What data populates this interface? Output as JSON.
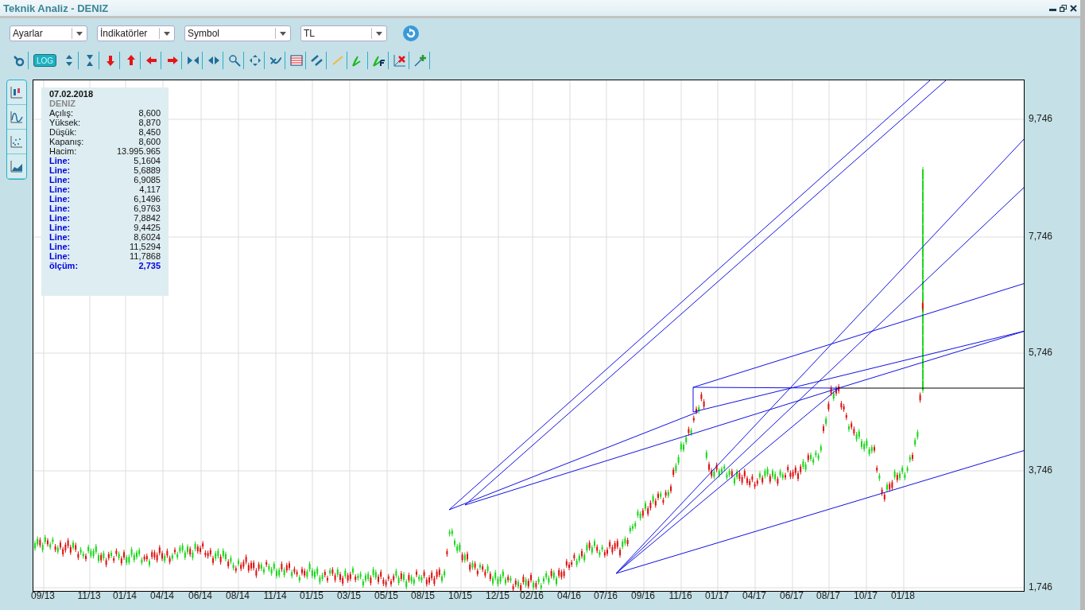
{
  "window": {
    "title": "Teknik Analiz - DENIZ"
  },
  "dropdowns": [
    {
      "value": "Ayarlar"
    },
    {
      "value": "İndikatörler"
    },
    {
      "value": "Symbol"
    },
    {
      "value": "TL"
    }
  ],
  "toolbar": {
    "log_label": "LOG",
    "log_on": true
  },
  "info": {
    "date": "07.02.2018",
    "symbol": "DENIZ",
    "rows": [
      {
        "kind": "price",
        "label": "Açılış:",
        "value": "8,600"
      },
      {
        "kind": "price",
        "label": "Yüksek:",
        "value": "8,870"
      },
      {
        "kind": "price",
        "label": "Düşük:",
        "value": "8,450"
      },
      {
        "kind": "price",
        "label": "Kapanış:",
        "value": "8,600"
      },
      {
        "kind": "price",
        "label": "Hacim:",
        "value": "13.995.965"
      },
      {
        "kind": "line",
        "label": "Line:",
        "value": "5,1604"
      },
      {
        "kind": "line",
        "label": "Line:",
        "value": "5,6889"
      },
      {
        "kind": "line",
        "label": "Line:",
        "value": "6,9085"
      },
      {
        "kind": "line",
        "label": "Line:",
        "value": "4,117"
      },
      {
        "kind": "line",
        "label": "Line:",
        "value": "6,1496"
      },
      {
        "kind": "line",
        "label": "Line:",
        "value": "6,9763"
      },
      {
        "kind": "line",
        "label": "Line:",
        "value": "7,8842"
      },
      {
        "kind": "line",
        "label": "Line:",
        "value": "9,4425"
      },
      {
        "kind": "line",
        "label": "Line:",
        "value": "8,6024"
      },
      {
        "kind": "line",
        "label": "Line:",
        "value": "11,5294"
      },
      {
        "kind": "line",
        "label": "Line:",
        "value": "11,7868"
      },
      {
        "kind": "measure",
        "label": "ölçüm:",
        "value": "2,735"
      }
    ]
  },
  "chart": {
    "y_labels": [
      "9,746",
      "7,746",
      "5,746",
      "3,746",
      "1,746"
    ],
    "x_labels": [
      "09/13",
      "11/13",
      "01/14",
      "04/14",
      "06/14",
      "08/14",
      "11/14",
      "01/15",
      "03/15",
      "05/15",
      "08/15",
      "10/15",
      "12/15",
      "02/16",
      "04/16",
      "07/16",
      "09/16",
      "11/16",
      "01/17",
      "04/17",
      "06/17",
      "08/17",
      "10/17",
      "01/18"
    ]
  }
}
